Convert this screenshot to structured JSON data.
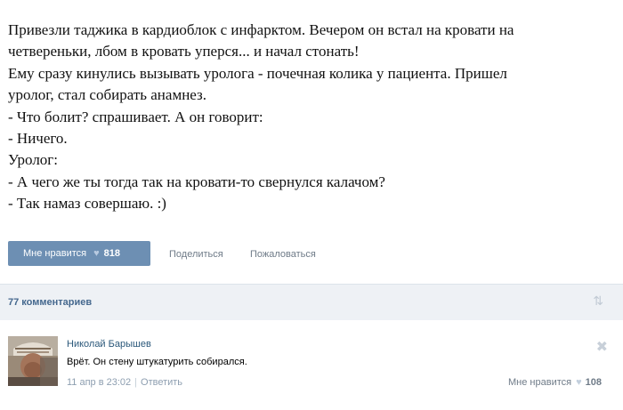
{
  "post": {
    "lines": [
      "Привезли таджика в кардиоблок с инфарктом. Вечером он встал на кровати на",
      "четвереньки, лбом в кровать уперся... и начал стонать!",
      "Ему сразу кинулись вызывать уролога - почечная колика у пациента. Пришел",
      "уролог, стал собирать анамнез.",
      "- Что болит? спрашивает. А он говорит:",
      "- Ничего.",
      "Уролог:",
      "- А чего же ты тогда так на кровати-то свернулся калачом?",
      "- Так намаз совершаю. :)"
    ]
  },
  "actions": {
    "like_label": "Мне нравится",
    "like_count": "818",
    "share_label": "Поделиться",
    "report_label": "Пожаловаться"
  },
  "comments": {
    "count_label": "77 комментариев",
    "items": [
      {
        "author": "Николай Барышев",
        "text": "Врёт. Он стену штукатурить собирался.",
        "date": "11 апр в 23:02",
        "reply_label": "Ответить",
        "like_label": "Мне нравится",
        "like_count": "108"
      }
    ]
  },
  "icons": {
    "heart": "heart-icon",
    "sort": "sort-icon",
    "close": "close-icon"
  },
  "colors": {
    "like_button_bg": "#6d8fb3",
    "link_blue": "#2b587a",
    "comments_bar_bg": "#eef1f5"
  }
}
